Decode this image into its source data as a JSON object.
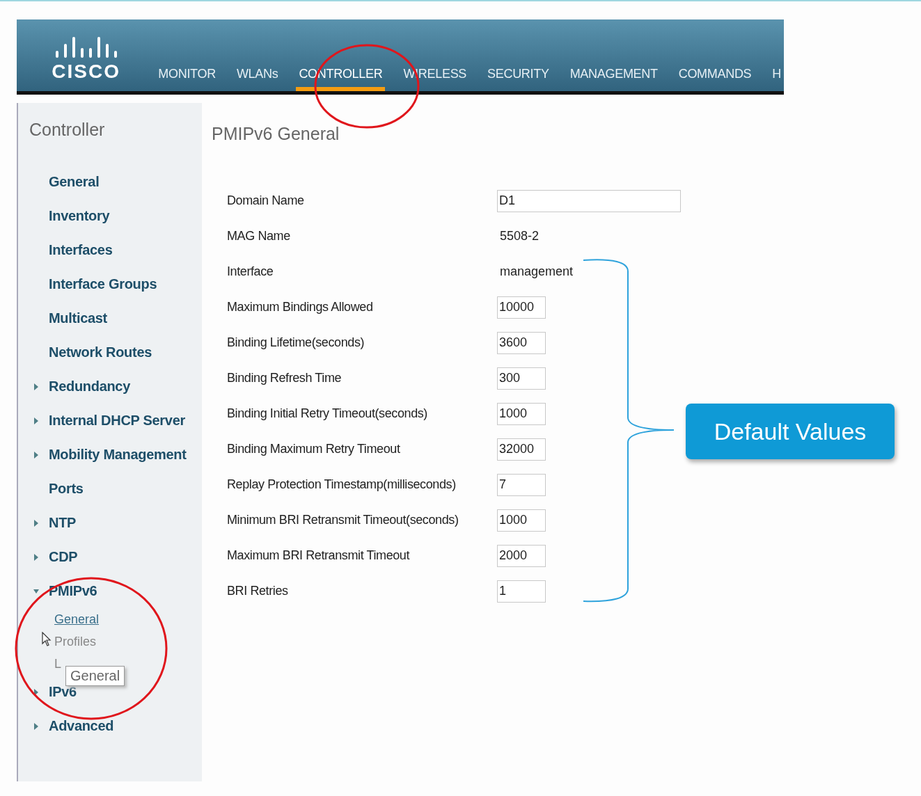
{
  "header": {
    "logo": "CISCO",
    "nav": [
      {
        "label": "MONITOR",
        "selected": false
      },
      {
        "label": "WLANs",
        "selected": false
      },
      {
        "label": "CONTROLLER",
        "selected": true
      },
      {
        "label": "WIRELESS",
        "selected": false
      },
      {
        "label": "SECURITY",
        "selected": false
      },
      {
        "label": "MANAGEMENT",
        "selected": false
      },
      {
        "label": "COMMANDS",
        "selected": false
      },
      {
        "label": "H",
        "selected": false
      }
    ]
  },
  "sidebar": {
    "title": "Controller",
    "items": [
      {
        "label": "General",
        "kind": "page"
      },
      {
        "label": "Inventory",
        "kind": "page"
      },
      {
        "label": "Interfaces",
        "kind": "page"
      },
      {
        "label": "Interface Groups",
        "kind": "page"
      },
      {
        "label": "Multicast",
        "kind": "page"
      },
      {
        "label": "Network Routes",
        "kind": "page"
      },
      {
        "label": "Redundancy",
        "kind": "folder",
        "expanded": false
      },
      {
        "label": "Internal DHCP Server",
        "kind": "folder",
        "expanded": false
      },
      {
        "label": "Mobility Management",
        "kind": "folder",
        "expanded": false
      },
      {
        "label": "Ports",
        "kind": "page"
      },
      {
        "label": "NTP",
        "kind": "folder",
        "expanded": false
      },
      {
        "label": "CDP",
        "kind": "folder",
        "expanded": false
      },
      {
        "label": "PMIPv6",
        "kind": "folder",
        "expanded": true,
        "children": [
          {
            "label": "General",
            "selected": true
          },
          {
            "label": "Profiles",
            "selected": false
          },
          {
            "label": "L",
            "selected": false
          }
        ]
      },
      {
        "label": "IPv6",
        "kind": "folder",
        "expanded": false
      },
      {
        "label": "Advanced",
        "kind": "folder",
        "expanded": false
      }
    ]
  },
  "tooltip": "General",
  "main": {
    "title": "PMIPv6 General",
    "fields": [
      {
        "label": "Domain Name",
        "kind": "wide-input",
        "value": "D1"
      },
      {
        "label": "MAG Name",
        "kind": "readonly",
        "value": "5508-2"
      },
      {
        "label": "Interface",
        "kind": "readonly",
        "value": "management"
      },
      {
        "label": "Maximum Bindings Allowed",
        "kind": "input",
        "value": "10000"
      },
      {
        "label": "Binding Lifetime(seconds)",
        "kind": "input",
        "value": "3600"
      },
      {
        "label": "Binding Refresh Time",
        "kind": "input",
        "value": "300"
      },
      {
        "label": "Binding Initial Retry Timeout(seconds)",
        "kind": "input",
        "value": "1000"
      },
      {
        "label": "Binding Maximum Retry Timeout",
        "kind": "input",
        "value": "32000"
      },
      {
        "label": "Replay Protection Timestamp(milliseconds)",
        "kind": "input",
        "value": "7"
      },
      {
        "label": "Minimum BRI Retransmit Timeout(seconds)",
        "kind": "input",
        "value": "1000"
      },
      {
        "label": "Maximum BRI Retransmit Timeout",
        "kind": "input",
        "value": "2000"
      },
      {
        "label": "BRI Retries",
        "kind": "input",
        "value": "1"
      }
    ]
  },
  "callout": "Default Values"
}
